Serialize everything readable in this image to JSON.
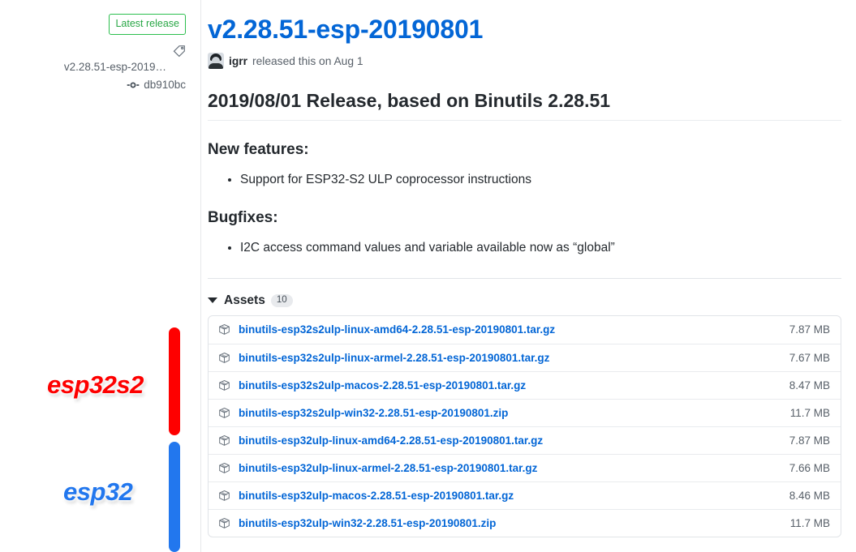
{
  "sidebar": {
    "badge_label": "Latest release",
    "tag_icon": "tag-icon",
    "tag_name": "v2.28.51-esp-2019…",
    "commit_icon": "commit-icon",
    "commit_sha": "db910bc"
  },
  "annotations": [
    {
      "id": "esp32s2",
      "label": "esp32s2",
      "color": "#fe0000",
      "bar": "vertical-bar"
    },
    {
      "id": "esp32",
      "label": "esp32",
      "color": "#2277ee",
      "bar": "vertical-bar"
    }
  ],
  "release": {
    "title": "v2.28.51-esp-20190801",
    "author_avatar": "avatar",
    "author": "igrr",
    "byline_suffix": "released this on Aug 1",
    "notes_title": "2019/08/01 Release, based on Binutils 2.28.51",
    "sections": [
      {
        "heading": "New features:",
        "items": [
          "Support for ESP32-S2 ULP coprocessor instructions"
        ]
      },
      {
        "heading": "Bugfixes:",
        "items": [
          "I2C access command values and variable available now as “global”"
        ]
      }
    ]
  },
  "assets": {
    "caret_icon": "chevron-down-icon",
    "label": "Assets",
    "count": "10",
    "rows": [
      {
        "icon": "package-icon",
        "name": "binutils-esp32s2ulp-linux-amd64-2.28.51-esp-20190801.tar.gz",
        "size": "7.87 MB"
      },
      {
        "icon": "package-icon",
        "name": "binutils-esp32s2ulp-linux-armel-2.28.51-esp-20190801.tar.gz",
        "size": "7.67 MB"
      },
      {
        "icon": "package-icon",
        "name": "binutils-esp32s2ulp-macos-2.28.51-esp-20190801.tar.gz",
        "size": "8.47 MB"
      },
      {
        "icon": "package-icon",
        "name": "binutils-esp32s2ulp-win32-2.28.51-esp-20190801.zip",
        "size": "11.7 MB"
      },
      {
        "icon": "package-icon",
        "name": "binutils-esp32ulp-linux-amd64-2.28.51-esp-20190801.tar.gz",
        "size": "7.87 MB"
      },
      {
        "icon": "package-icon",
        "name": "binutils-esp32ulp-linux-armel-2.28.51-esp-20190801.tar.gz",
        "size": "7.66 MB"
      },
      {
        "icon": "package-icon",
        "name": "binutils-esp32ulp-macos-2.28.51-esp-20190801.tar.gz",
        "size": "8.46 MB"
      },
      {
        "icon": "package-icon",
        "name": "binutils-esp32ulp-win32-2.28.51-esp-20190801.zip",
        "size": "11.7 MB"
      }
    ]
  },
  "colors": {
    "link": "#0366d6",
    "green": "#2cbe4e",
    "muted": "#586069",
    "esp32s2": "#fe0000",
    "esp32": "#2277ee"
  }
}
